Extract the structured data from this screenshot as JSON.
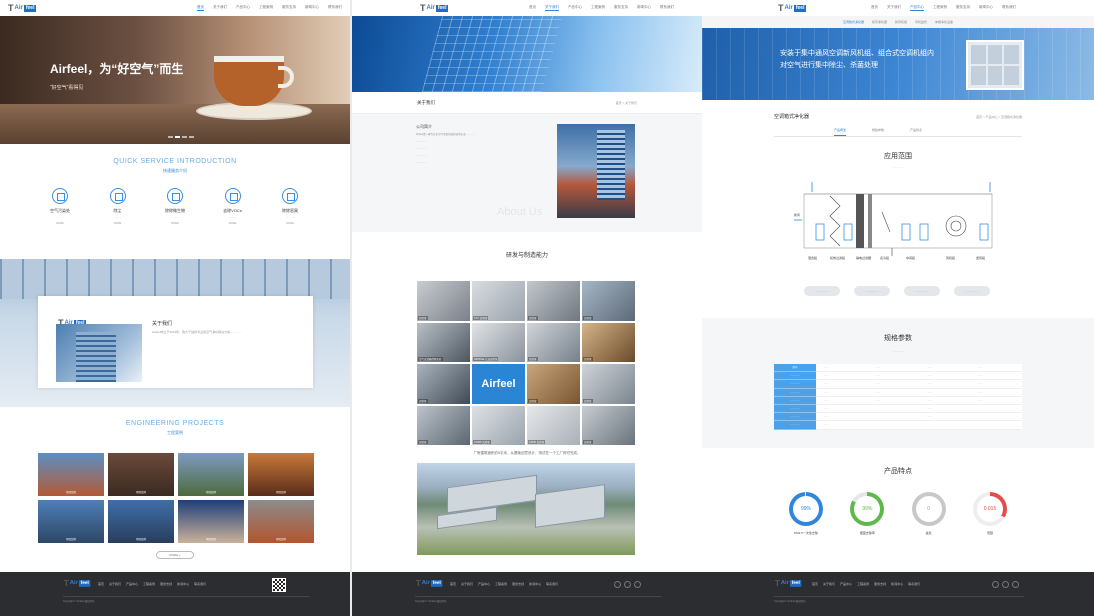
{
  "brand": {
    "logo_mark": "T",
    "logo_text": "Air",
    "logo_box": "feel"
  },
  "col1": {
    "nav": [
      "首页",
      "关于我们",
      "产品中心",
      "工程案例",
      "服务支持",
      "新闻中心",
      "联系我们"
    ],
    "hero_title": "Airfeel，为“好空气”而生",
    "hero_sub": "“好空气”看得见",
    "service_en": "QUICK SERVICE INTRODUCTION",
    "service_cn": "快速服务介绍",
    "services": [
      {
        "label": "空气污染处",
        "desc": "…………",
        "more": "MORE"
      },
      {
        "label": "除尘",
        "desc": "…………",
        "more": "MORE"
      },
      {
        "label": "除除微生物",
        "desc": "…………",
        "more": "MORE"
      },
      {
        "label": "去除VOCs",
        "desc": "…………",
        "more": "MORE"
      },
      {
        "label": "除除恶臭",
        "desc": "…………",
        "more": "MORE"
      }
    ],
    "about_title": "关于我们",
    "about_text": "Airfeel成立于2013年，致力于提供专业的空气净化解决方案…………",
    "projects_en": "ENGINEERING PROJECTS",
    "projects_cn": "工程案例",
    "projects": [
      "项目案例",
      "项目案例",
      "项目案例",
      "项目案例",
      "项目案例",
      "项目案例",
      "项目案例",
      "项目案例"
    ],
    "more_btn": "MORE +",
    "footer_menu": [
      "首页",
      "关于我们",
      "产品中心",
      "工程案例",
      "服务支持",
      "新闻中心",
      "联系我们"
    ],
    "footer_copy": "Copyright © Airfeel 版权所有"
  },
  "col2": {
    "nav": [
      "首页",
      "关于我们",
      "产品中心",
      "工程案例",
      "服务支持",
      "新闻中心",
      "联系我们"
    ],
    "band_title": "关于我们",
    "band_crumb": "首页 > 关于我们",
    "about_head": "公司简介",
    "about_paras": [
      "Airfeel是一家专注于空气净化的高新技术企业…………",
      "…………",
      "…………",
      "…………",
      "…………"
    ],
    "about_bg": "About Us",
    "rd_title": "研发与制造能力",
    "rd_sub": "……………………",
    "labs": [
      "实验室",
      "CTC 实验室",
      "实验室",
      "实验室",
      "空气过滤器性能实验",
      "ASHRAE 认证实验室",
      "实验室",
      "Airfeel",
      "实验室",
      "实验室",
      "实验室",
      "实验室",
      "实验室",
      "COMS 实验室",
      "CADR 实验室",
      "实验室"
    ],
    "plant_caption": "厂房建筑面积约5平米，从基础创意设计、测试在一个工厂即可完成。",
    "footer_menu": [
      "首页",
      "关于我们",
      "产品中心",
      "工程案例",
      "服务支持",
      "新闻中心",
      "联系我们"
    ],
    "footer_copy": "Copyright © Airfeel 版权所有"
  },
  "col3": {
    "nav": [
      "首页",
      "关于我们",
      "产品中心",
      "工程案例",
      "服务支持",
      "新闻中心",
      "联系我们"
    ],
    "subnav": [
      "空调箱式净化器",
      "新风净化器",
      "新风机组",
      "风机盘管",
      "末端净化设备"
    ],
    "banner_l1": "安装于集中通风空调新风机组、组合式空调机组内",
    "banner_l2": "对空气进行集中除尘、杀菌处理",
    "product_head": "空调箱式净化器",
    "product_crumb": "首页 > 产品中心 > 空调箱式净化器",
    "tabs": [
      "产品概述",
      "规格参数",
      "产品特点"
    ],
    "app_title": "应用范围",
    "app_sub": "…………",
    "diagram_labels": [
      "回风",
      "新风",
      "送风",
      "混合段",
      "初效过滤段",
      "静电过滤器",
      "表冷段",
      "中间段",
      "风机段",
      "送风段"
    ],
    "buttons": [
      "…………",
      "…………",
      "…………",
      "…………"
    ],
    "spec_title": "规格参数",
    "spec_sub": "…………",
    "spec_rows": [
      "型号",
      "…………",
      "…………",
      "…………",
      "…………",
      "…………",
      "…………",
      "…………"
    ],
    "feat_title": "产品特点",
    "feat_sub": "…………",
    "gauges": [
      {
        "val": "99%",
        "label": "PM2.5一次性去除",
        "color": "#2f86dd"
      },
      {
        "val": "99%",
        "label": "细菌去除率",
        "color": "#5fb84a"
      },
      {
        "val": "0",
        "label": "臭氧",
        "color": "#c8c8c8"
      },
      {
        "val": "0.015",
        "label": "低阻",
        "color": "#e44b4b"
      }
    ],
    "footer_menu": [
      "首页",
      "关于我们",
      "产品中心",
      "工程案例",
      "服务支持",
      "新闻中心",
      "联系我们"
    ],
    "footer_copy": "Copyright © Airfeel 版权所有"
  }
}
